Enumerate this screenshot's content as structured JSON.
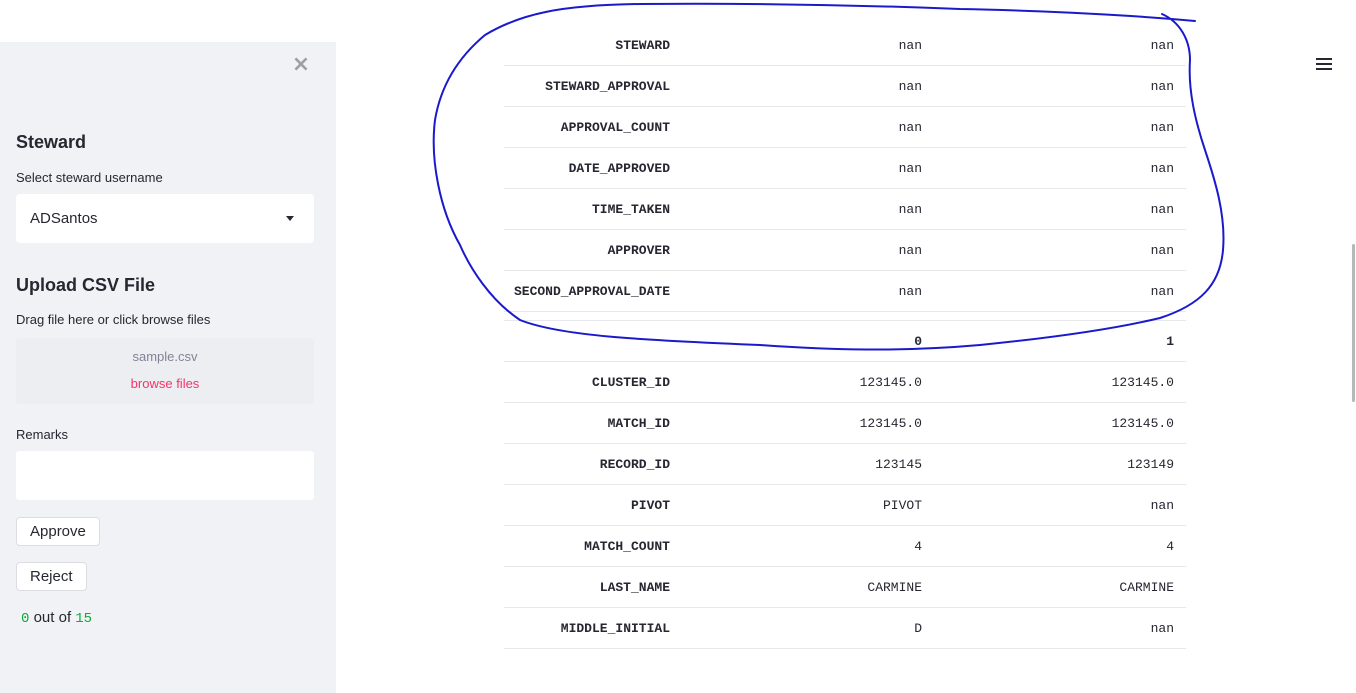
{
  "sidebar": {
    "close_icon": "×",
    "steward_heading": "Steward",
    "steward_label": "Select steward username",
    "steward_value": "ADSantos",
    "upload_heading": "Upload CSV File",
    "upload_label": "Drag file here or click browse files",
    "file_name": "sample.csv",
    "browse_label": "browse files",
    "remarks_label": "Remarks",
    "remarks_value": "",
    "approve_label": "Approve",
    "reject_label": "Reject",
    "progress_current": "0",
    "progress_text": "out of",
    "progress_total": "15"
  },
  "table_top": {
    "rows": [
      {
        "key": "STEWARD",
        "c0": "nan",
        "c1": "nan"
      },
      {
        "key": "STEWARD_APPROVAL",
        "c0": "nan",
        "c1": "nan"
      },
      {
        "key": "APPROVAL_COUNT",
        "c0": "nan",
        "c1": "nan"
      },
      {
        "key": "DATE_APPROVED",
        "c0": "nan",
        "c1": "nan"
      },
      {
        "key": "TIME_TAKEN",
        "c0": "nan",
        "c1": "nan"
      },
      {
        "key": "APPROVER",
        "c0": "nan",
        "c1": "nan"
      },
      {
        "key": "SECOND_APPROVAL_DATE",
        "c0": "nan",
        "c1": "nan"
      }
    ]
  },
  "table_bottom": {
    "header": {
      "key": "",
      "c0": "0",
      "c1": "1"
    },
    "rows": [
      {
        "key": "CLUSTER_ID",
        "c0": "123145.0",
        "c1": "123145.0"
      },
      {
        "key": "MATCH_ID",
        "c0": "123145.0",
        "c1": "123145.0"
      },
      {
        "key": "RECORD_ID",
        "c0": "123145",
        "c1": "123149"
      },
      {
        "key": "PIVOT",
        "c0": "PIVOT",
        "c1": "nan"
      },
      {
        "key": "MATCH_COUNT",
        "c0": "4",
        "c1": "4"
      },
      {
        "key": "LAST_NAME",
        "c0": "CARMINE",
        "c1": "CARMINE"
      },
      {
        "key": "MIDDLE_INITIAL",
        "c0": "D",
        "c1": "nan"
      }
    ]
  },
  "colors": {
    "sidebar_bg": "#f0f2f6",
    "accent": "#f63366",
    "progress_number": "#09ab3b",
    "annotation_ink": "#1a1acc"
  },
  "icons": {
    "close": "close-icon",
    "dropdown": "chevron-down-icon",
    "menu": "hamburger-menu-icon"
  }
}
